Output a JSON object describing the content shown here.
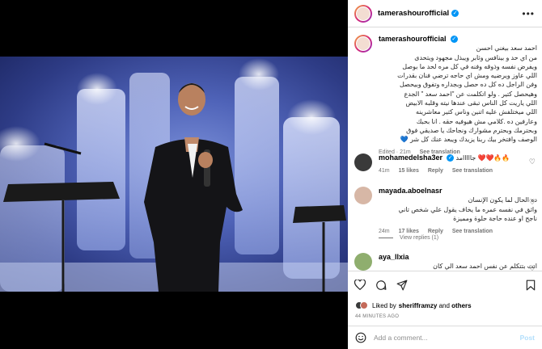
{
  "header": {
    "username": "tamerashourofficial"
  },
  "caption": {
    "username": "tamerashourofficial",
    "text": "احمد سعد بيغني احسن\nمن اي حد و بينافس وثابر ويبذل مجهود ويتحدى\nويفرض نفسه وذوقه وفنه في كل مره لحد ما بوصل\nاللي عاوز ويرضيه ومش اي حاجه ترضي فنان بقدرات\nوفن الراجل ده كل ده حصل وبجداره وتفوق وبيحصل\nوهيحصل كتير . ولو اتكلمت عن \"احمد سعد \" الجدع\nاللي ياريت كل الناس تبقى عندها نيته وقلبه الابيض\nاللي ميختلفش عليه اتنين وناس كتير معاشرينه\nوعارفين ده .كلامي مش هيوفيه حقه . انا بحبك\nوبحترمك وبحترم مشوارك ونجاحك يا صديقي فوق\nالوصف وافتخر بيك ربنا يزيدك ويبعد عنك كل شر 💙",
    "meta": "Edited · 21m",
    "see_translation": "See translation"
  },
  "comments": [
    {
      "username": "mohamedelsha3er",
      "text": "جااااامد ❤️❤️🔥🔥",
      "time": "41m",
      "likes": "15 likes",
      "reply": "Reply",
      "see_translation": "See translation"
    },
    {
      "username": "mayada.aboelnasr",
      "text": "ده الحال لما يكون الإنسان\nواثق في نفسه عمره ما يخاف يقول علي شخص تاني\nناجح او عنده حاجة حلوة ومميزة",
      "time": "24m",
      "likes": "17 likes",
      "reply": "Reply",
      "see_translation": "See translation"
    },
    {
      "username": "aya_llxia",
      "text": "انت بتتكلم عن نفس احمد سعد الي كان\nبيعنف مراته؟؟؟"
    }
  ],
  "view_replies": "View replies (1)",
  "liked_by": {
    "prefix": "Liked by ",
    "user": "sherifframzy",
    "and": " and ",
    "others": "others"
  },
  "time_ago": "44 MINUTES AGO",
  "add_comment": {
    "placeholder": "Add a comment...",
    "post": "Post"
  },
  "colors": {
    "verified": "#0095f6",
    "stage_blue": "#4f63b8",
    "post_disabled": "#b2dffc"
  }
}
